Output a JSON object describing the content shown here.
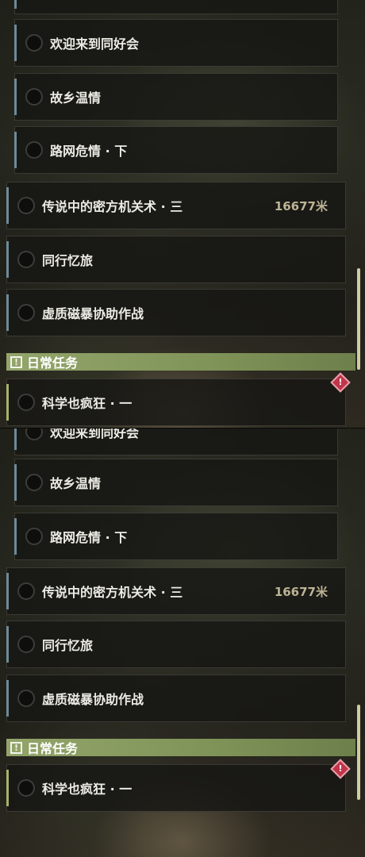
{
  "colors": {
    "main_quest_accent": "#6f8a99",
    "daily_quest_accent": "#a8b26a",
    "section_header": "#8ea064",
    "alert": "#c1354a",
    "distance_text": "#bdb394"
  },
  "side_quests": [
    {
      "label": "欢迎来到同好会"
    },
    {
      "label": "故乡温情"
    },
    {
      "label": "路网危情 · 下"
    }
  ],
  "main_quests": [
    {
      "label": "传说中的密方机关术 · 三",
      "distance": "16677米"
    },
    {
      "label": "同行忆旅"
    },
    {
      "label": "虚质磁暴协助作战"
    }
  ],
  "daily_section": {
    "icon": "exclamation-box-icon",
    "title": "日常任务",
    "bang": "!"
  },
  "daily_quests": [
    {
      "label": "科学也疯狂 · 一",
      "alert_icon": "red-diamond-alert-icon",
      "alert_glyph": "!"
    }
  ]
}
